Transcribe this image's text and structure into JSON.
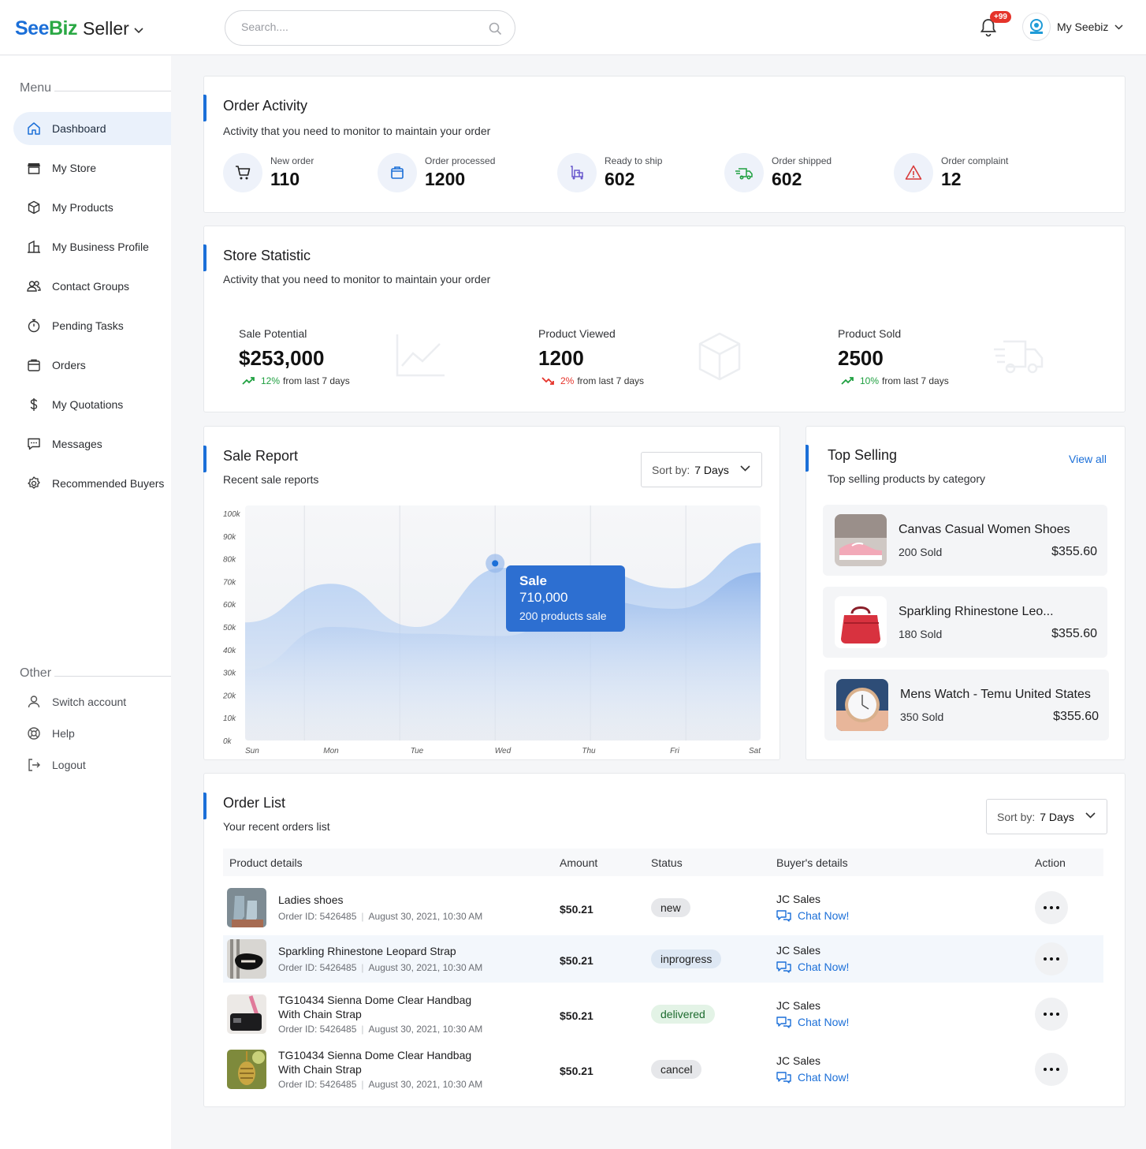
{
  "header": {
    "logo_see": "See",
    "logo_biz": "Biz",
    "logo_seller": "Seller",
    "search_placeholder": "Search....",
    "notification_badge": "+99",
    "account_name": "My Seebiz",
    "accent_color": "#1b6fd8"
  },
  "sidebar": {
    "menu_heading": "Menu",
    "items": [
      {
        "label": "Dashboard",
        "icon": "home-icon",
        "active": true
      },
      {
        "label": "My Store",
        "icon": "store-icon"
      },
      {
        "label": "My Products",
        "icon": "cube-icon"
      },
      {
        "label": "My Business Profile",
        "icon": "building-icon"
      },
      {
        "label": "Contact Groups",
        "icon": "users-icon"
      },
      {
        "label": "Pending Tasks",
        "icon": "stopwatch-icon"
      },
      {
        "label": "Orders",
        "icon": "bag-icon"
      },
      {
        "label": "My Quotations",
        "icon": "dollar-icon"
      },
      {
        "label": "Messages",
        "icon": "message-icon"
      },
      {
        "label": "Recommended Buyers",
        "icon": "badge-check-icon"
      }
    ],
    "other_heading": "Other",
    "other_items": [
      {
        "label": "Switch account",
        "icon": "user-icon"
      },
      {
        "label": "Help",
        "icon": "lifebuoy-icon"
      },
      {
        "label": "Logout",
        "icon": "logout-icon"
      }
    ]
  },
  "order_activity": {
    "title": "Order Activity",
    "subtitle": "Activity that you need to monitor to maintain your order",
    "stats": [
      {
        "label": "New order",
        "value": "110",
        "icon": "cart-icon"
      },
      {
        "label": "Order processed",
        "value": "1200",
        "icon": "box-icon"
      },
      {
        "label": "Ready to ship",
        "value": "602",
        "icon": "trolley-icon"
      },
      {
        "label": "Order shipped",
        "value": "602",
        "icon": "truck-icon"
      },
      {
        "label": "Order complaint",
        "value": "12",
        "icon": "warning-icon"
      }
    ]
  },
  "store_statistic": {
    "title": "Store Statistic",
    "subtitle": "Activity that you need to monitor to maintain your order",
    "items": [
      {
        "label": "Sale Potential",
        "value": "$253,000",
        "pct": "12%",
        "trend": "up",
        "from": "from last 7 days"
      },
      {
        "label": "Product Viewed",
        "value": "1200",
        "pct": "2%",
        "trend": "down",
        "from": "from last 7 days"
      },
      {
        "label": "Product Sold",
        "value": "2500",
        "pct": "10%",
        "trend": "up",
        "from": "from last 7 days"
      }
    ]
  },
  "sale_report": {
    "title": "Sale Report",
    "subtitle": "Recent sale reports",
    "sort_label": "Sort by:",
    "sort_value": "7 Days",
    "tooltip": {
      "title": "Sale",
      "value": "710,000",
      "note": "200 products sale"
    }
  },
  "chart_data": {
    "type": "area",
    "x": [
      "Sun",
      "Mon",
      "Tue",
      "Wed",
      "Thu",
      "Fri",
      "Sat"
    ],
    "ylim": [
      0,
      100
    ],
    "y_ticks": [
      "0k",
      "10k",
      "20k",
      "30k",
      "40k",
      "50k",
      "60k",
      "70k",
      "80k",
      "90k",
      "100k"
    ],
    "series": [
      {
        "values": [
          52,
          69,
          50,
          76,
          75,
          67,
          87
        ],
        "color": "#a9c8f2"
      },
      {
        "values": [
          31,
          50,
          47,
          46,
          62,
          58,
          74
        ],
        "color": "#8fb4ea"
      }
    ],
    "highlight": {
      "x": "Wed",
      "y": 78
    },
    "grid": true
  },
  "top_selling": {
    "title": "Top Selling",
    "subtitle": "Top selling products by category",
    "view_all": "View all",
    "items": [
      {
        "name": "Canvas Casual Women Shoes",
        "sold": "200 Sold",
        "price": "$355.60"
      },
      {
        "name": "Sparkling Rhinestone Leo...",
        "sold": "180 Sold",
        "price": "$355.60"
      },
      {
        "name": "Mens Watch - Temu United States",
        "sold": "350 Sold",
        "price": "$355.60"
      }
    ]
  },
  "order_list": {
    "title": "Order List",
    "subtitle": "Your recent orders list",
    "sort_label": "Sort by:",
    "sort_value": "7 Days",
    "columns": [
      "Product details",
      "Amount",
      "Status",
      "Buyer's details",
      "Action"
    ],
    "rows": [
      {
        "product": "Ladies shoes",
        "order_id": "Order ID: 5426485",
        "date": "August 30, 2021, 10:30 AM",
        "amount": "$50.21",
        "status": "new",
        "buyer": "JC Sales",
        "chat": "Chat Now!"
      },
      {
        "product": "Sparkling Rhinestone Leopard Strap",
        "order_id": "Order ID: 5426485",
        "date": "August 30, 2021, 10:30 AM",
        "amount": "$50.21",
        "status": "inprogress",
        "buyer": "JC Sales",
        "chat": "Chat Now!"
      },
      {
        "product": "TG10434 Sienna Dome Clear Handbag With Chain Strap",
        "order_id": "Order ID: 5426485",
        "date": "August 30, 2021, 10:30 AM",
        "amount": "$50.21",
        "status": "delivered",
        "buyer": "JC Sales",
        "chat": "Chat Now!"
      },
      {
        "product": "TG10434 Sienna Dome Clear Handbag With Chain Strap",
        "order_id": "Order ID: 5426485",
        "date": "August 30, 2021, 10:30 AM",
        "amount": "$50.21",
        "status": "cancel",
        "buyer": "JC Sales",
        "chat": "Chat Now!"
      }
    ]
  }
}
